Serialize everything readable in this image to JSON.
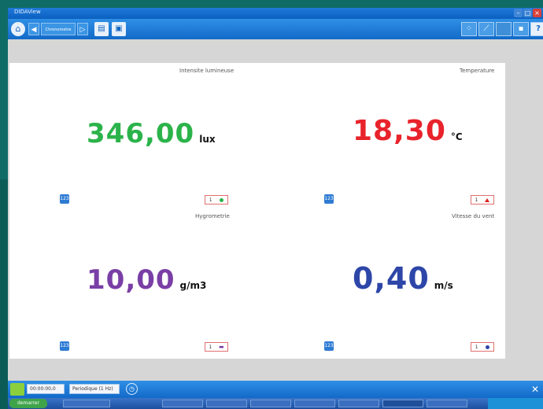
{
  "window": {
    "title": "DIDAView"
  },
  "toolbar": {
    "home_icon": "home-icon",
    "back_icon": "arrow-left-icon",
    "mode_label": "Chronometre",
    "play_icon": "play-icon",
    "new_doc_icon": "document-icon",
    "save_icon": "save-icon",
    "right_icons": [
      "grid-icon",
      "graph-icon",
      "table-icon",
      "camera-icon",
      "help-icon"
    ]
  },
  "meters": [
    {
      "label": "Intensite lumineuse",
      "value": "346,00",
      "unit": "lux",
      "color": "#2bb34a",
      "channel": "1",
      "marker": "green-dot-icon"
    },
    {
      "label": "Temperature",
      "value": "18,30",
      "unit": "°C",
      "color": "#e8232b",
      "channel": "1",
      "marker": "red-triangle-icon"
    },
    {
      "label": "Hygrometrie",
      "value": "10,00",
      "unit": "g/m3",
      "color": "#7a3fa6",
      "channel": "1",
      "marker": "purple-bars-icon"
    },
    {
      "label": "Vitesse du vent",
      "value": "0,40",
      "unit": "m/s",
      "color": "#2d46a8",
      "channel": "1",
      "marker": "blue-dot-icon"
    }
  ],
  "statusbar": {
    "time": "00:00:00,0",
    "period": "Periodique (1 Hz)"
  },
  "taskbar": {
    "start_label": "demarrer",
    "tasks": [
      "",
      "",
      "",
      "",
      "",
      "",
      "",
      ""
    ]
  }
}
